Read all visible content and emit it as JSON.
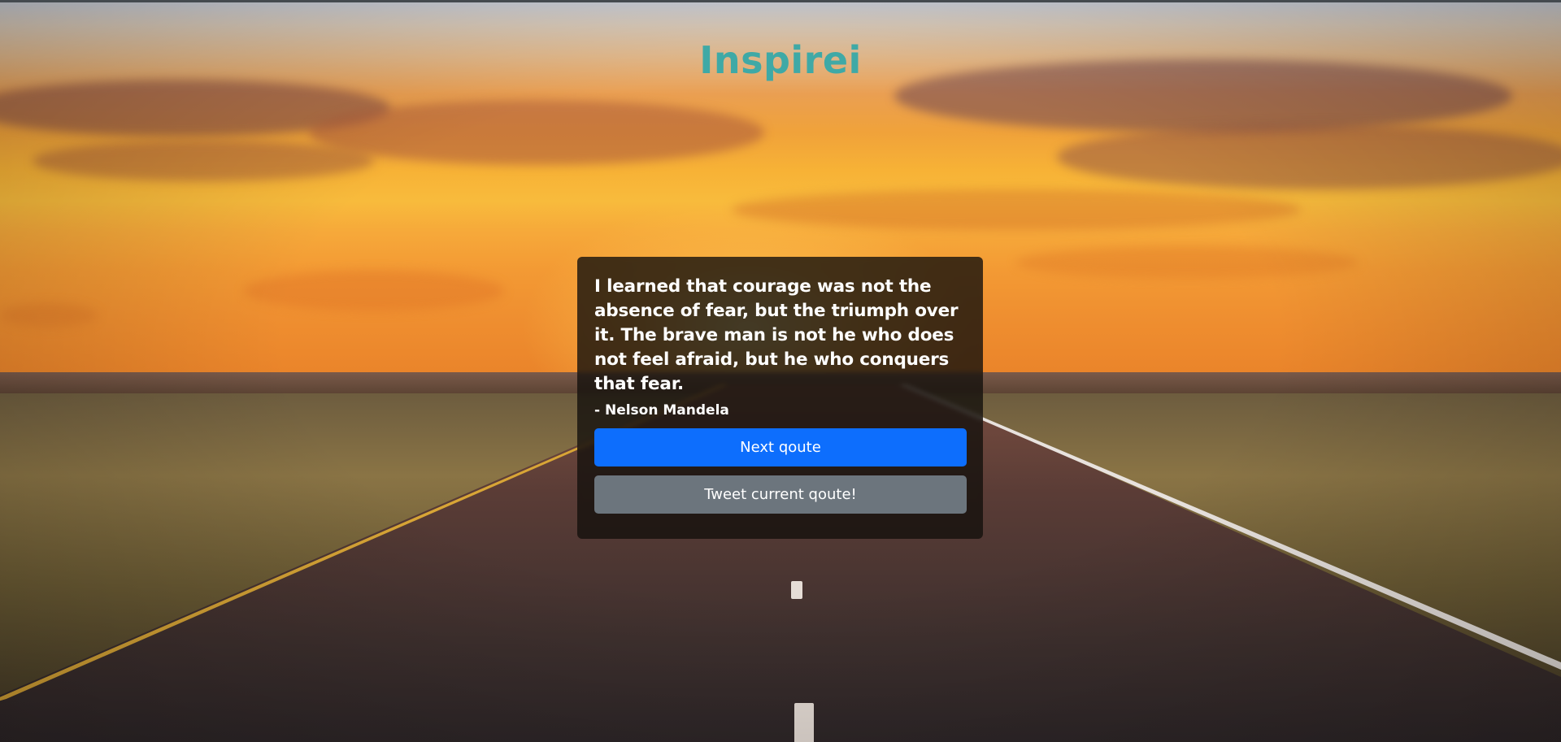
{
  "app": {
    "title": "Inspirei",
    "title_color": "#3fa9a6"
  },
  "quote": {
    "text": "I learned that courage was not the absence of fear, but the triumph over it. The brave man is not he who does not feel afraid, but he who conquers that fear.",
    "author": "- Nelson Mandela"
  },
  "actions": {
    "next_label": "Next qoute",
    "tweet_label": "Tweet current qoute!",
    "next_color": "#0d6efd",
    "tweet_color": "#6c757d"
  },
  "background": {
    "description_icon": "sunset-road-background"
  }
}
